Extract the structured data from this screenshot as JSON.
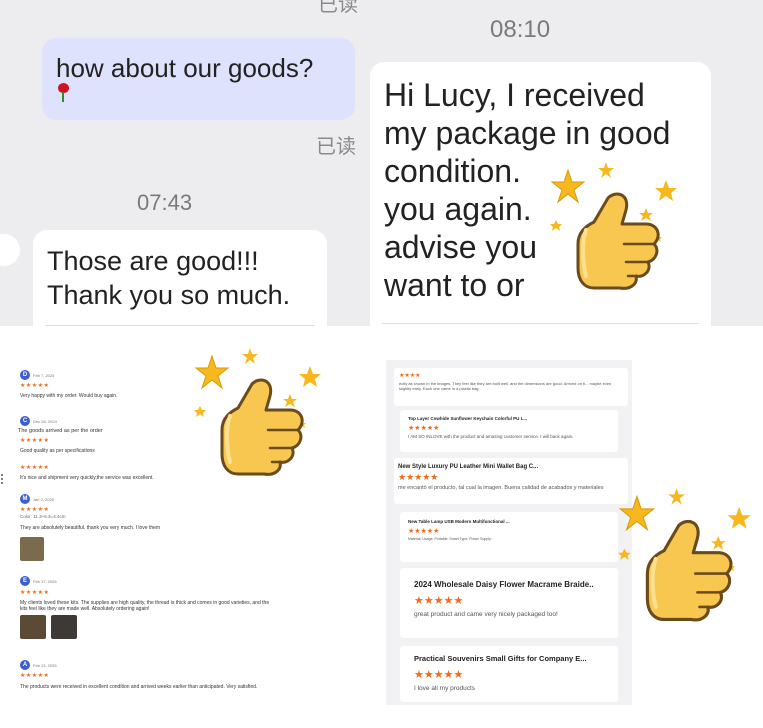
{
  "chat_left": {
    "top_status": "已读",
    "message_out": "how about our goods?",
    "read_status": "已读",
    "time": "07:43",
    "reply_line1": "Those are good!!!",
    "reply_line2": "Thank you so much."
  },
  "chat_right": {
    "time": "08:10",
    "lines": [
      "Hi Lucy, I received",
      "my package in good",
      "condition.",
      "you again.",
      "advise you",
      "want to or"
    ]
  },
  "reviews_left": [
    {
      "initial": "D",
      "date": "Feb 7, 2025",
      "stars": "★★★★★",
      "text": "Very happy with my order. Would buy again."
    },
    {
      "initial": "C",
      "date": "Dec 26, 2024",
      "heading": "The goods arrived as per the order",
      "stars": "★★★★★",
      "text": "Good quality as per specifications"
    },
    {
      "stars": "★★★★★",
      "text": "It's nice and shipment very quickly,the service was excellent."
    },
    {
      "initial": "M",
      "date": "Jan 2, 2025",
      "stars": "★★★★★",
      "variant": "Color: 11.3+6.3=4.4cm",
      "text": "They are absolutely beautiful. thank you very much. I love them"
    },
    {
      "initial": "E",
      "date": "Feb 17, 2025",
      "stars": "★★★★★",
      "text": "My clients loved these kits. The supplies are high quality, the thread is thick and comes in good varieties, and the kits feel like they are made well. Absolutely ordering again!"
    },
    {
      "initial": "A",
      "date": "Feb 13, 2025",
      "stars": "★★★★★",
      "text": "The products were received in excellent condition and arrived weeks earlier than anticipated. Very satisfied."
    }
  ],
  "reviews_right": [
    {
      "title": "",
      "stars": "★★★★",
      "text": "ectly as shown in the images. They feel like they are built well, and the dimensions are good. Arrived on ti... maybe even slightly early. Each one came in a plastic bag."
    },
    {
      "title": "Top Layer Cowhide Sunflower Keychain Colorful PU L...",
      "stars": "★★★★★",
      "text": "I AM SO INLOVE with the product and amazing customer service. I will back again."
    },
    {
      "title": "New Style Luxury PU Leather Mini Wallet Bag C...",
      "stars": "★★★★★",
      "text": "me encantó el producto, tal cual la imagen. Buena calidad de acabados y materiales"
    },
    {
      "title": "New Table Lamp USB Modern Multifunctional ...",
      "stars": "★★★★★",
      "text": "Material:  Usage:  Portable:  Smart Type:  Power Supply:"
    },
    {
      "title": "2024 Wholesale Daisy Flower Macrame Braide..",
      "stars": "★★★★★",
      "text": "great product and came very nicely packaged too!"
    },
    {
      "title": "Practical Souvenirs Small Gifts for Company E...",
      "stars": "★★★★★",
      "text": "I love all my products"
    }
  ],
  "icons": {
    "thumbs_up": "thumbs-up-sticker-icon",
    "rose": "rose-emoji-icon"
  },
  "colors": {
    "chat_bg": "#ededf0",
    "outgoing_bubble": "#dfe2fd",
    "star_orange": "#f06a1c",
    "sticker_yellow": "#f7c74f"
  }
}
